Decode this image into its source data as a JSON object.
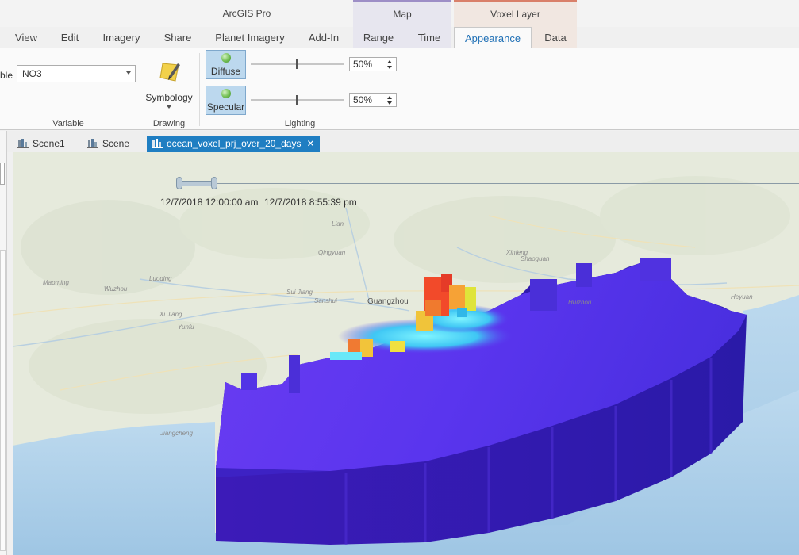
{
  "app": {
    "title": "ArcGIS Pro"
  },
  "contextual_groups": [
    {
      "label": "Map",
      "accent": "#9d8ec6"
    },
    {
      "label": "Voxel Layer",
      "accent": "#d9806a"
    }
  ],
  "tabs": [
    "View",
    "Edit",
    "Imagery",
    "Share",
    "Planet Imagery",
    "Add-In",
    "Range",
    "Time",
    "Appearance",
    "Data"
  ],
  "active_tab": "Appearance",
  "ribbon": {
    "variable": {
      "label_cut": "ble",
      "value": "NO3",
      "group_label": "Variable"
    },
    "drawing": {
      "symbology_label": "Symbology",
      "group_label": "Drawing"
    },
    "lighting": {
      "group_label": "Lighting",
      "diffuse": {
        "label": "Diffuse",
        "value": "50%",
        "level": 0.5
      },
      "specular": {
        "label": "Specular",
        "value": "50%",
        "level": 0.5
      }
    }
  },
  "view_tabs": [
    {
      "label": "Scene1",
      "active": false
    },
    {
      "label": "Scene",
      "active": false
    },
    {
      "label": "ocean_voxel_prj_over_20_days",
      "active": true,
      "close": "✕"
    }
  ],
  "time_slider": {
    "start": "12/7/2018 12:00:00 am",
    "end": "12/7/2018 8:55:39 pm"
  },
  "map_labels": {
    "guangzhou": "Guangzhou",
    "sanshui": "Sanshui",
    "jiangcheng": "Jiangcheng",
    "yunfu": "Yunfu",
    "lian": "Lian",
    "qingyuan": "Qingyuan",
    "xinfeng": "Xinfeng",
    "huizhou": "Huizhou",
    "shaoguan": "Shaoguan",
    "wuzhou": "Wuzhou",
    "luoding": "Luoding",
    "xijiang": "Xi Jiang",
    "suijiang": "Sui Jiang",
    "heyuan": "Heyuan",
    "maoming": "Maoming"
  },
  "colors": {
    "accent": "#1f7ec2",
    "voxel_dark": "#3a1ab8",
    "voxel_light": "#6a3df5",
    "sea": "#a8cce8",
    "land": "#e7ebde"
  }
}
